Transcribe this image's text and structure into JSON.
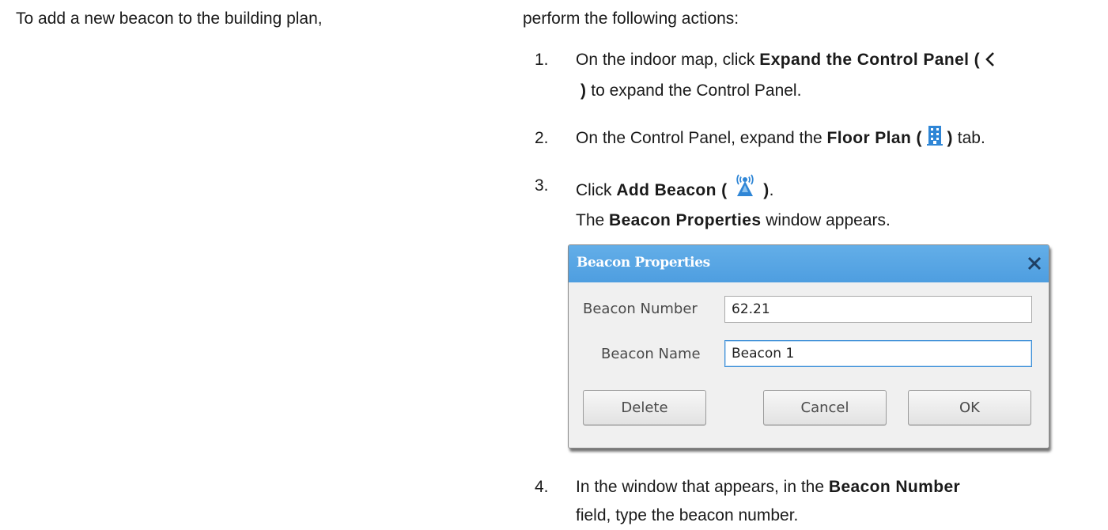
{
  "intro": {
    "left": "To add a new beacon to the building plan,",
    "right": "perform the following actions:"
  },
  "steps": [
    {
      "num": "1.",
      "line1_prefix": "On the indoor map, click ",
      "line1_bold": "Expand the Control Panel (",
      "line2_bold": ")",
      "line2_suffix": " to expand the Control Panel.",
      "icon": "chevron-left-icon"
    },
    {
      "num": "2.",
      "prefix": "On the Control Panel, expand the ",
      "bold": "Floor Plan (",
      "bold_close": ")",
      "suffix": " tab.",
      "icon": "building-icon"
    },
    {
      "num": "3.",
      "prefix": "Click ",
      "bold": "Add Beacon (",
      "bold_close": ")",
      "suffix": ".",
      "line2_prefix": "The ",
      "line2_bold": "Beacon Properties",
      "line2_suffix": " window appears.",
      "icon": "beacon-icon"
    },
    {
      "num": "4.",
      "line1_prefix": "In the window that appears, in the ",
      "line1_bold": "Beacon Number",
      "line2": "field, type the beacon number."
    }
  ],
  "dialog": {
    "title": "Beacon Properties",
    "number_label": "Beacon Number",
    "number_value": "62.21",
    "name_label": "Beacon Name",
    "name_value": "Beacon 1",
    "delete_label": "Delete",
    "cancel_label": "Cancel",
    "ok_label": "OK",
    "titlebar_color": "#4e9ee0"
  }
}
